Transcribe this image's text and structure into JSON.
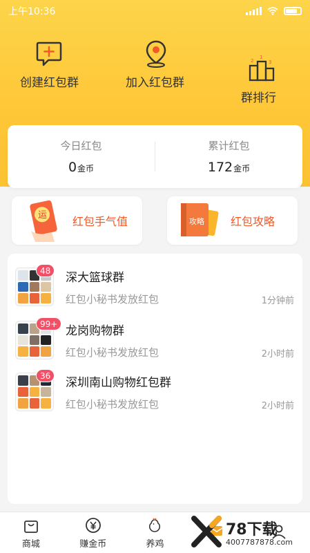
{
  "status_bar": {
    "time": "上午10:36"
  },
  "actions": {
    "create": "创建红包群",
    "join": "加入红包群",
    "rank": "群排行"
  },
  "stats": {
    "today_label": "今日红包",
    "today_value": "0",
    "total_label": "累计红包",
    "total_value": "172",
    "unit": "金币"
  },
  "promos": {
    "luck": "红包手气值",
    "guide": "红包攻略",
    "luck_icon_char": "运",
    "guide_icon_text": "攻略"
  },
  "groups": [
    {
      "name": "深大篮球群",
      "message": "红包小秘书发放红包",
      "time": "1分钟前",
      "badge": "48"
    },
    {
      "name": "龙岗购物群",
      "message": "红包小秘书发放红包",
      "time": "2小时前",
      "badge": "99+"
    },
    {
      "name": "深圳南山购物红包群",
      "message": "红包小秘书发放红包",
      "time": "2小时前",
      "badge": "36"
    }
  ],
  "tabs": [
    {
      "label": "商城",
      "icon": "shop-bag-icon"
    },
    {
      "label": "赚金币",
      "icon": "yen-coin-icon"
    },
    {
      "label": "养鸡",
      "icon": "chicken-icon"
    },
    {
      "label": "",
      "icon": "red-envelope-icon"
    },
    {
      "label": "",
      "icon": "profile-icon"
    }
  ],
  "watermark": {
    "brand": "78下载",
    "url": "4007787878.com"
  },
  "colors": {
    "brand_yellow": "#fec737",
    "accent_orange": "#f05a28",
    "badge_pink": "#f25067"
  }
}
